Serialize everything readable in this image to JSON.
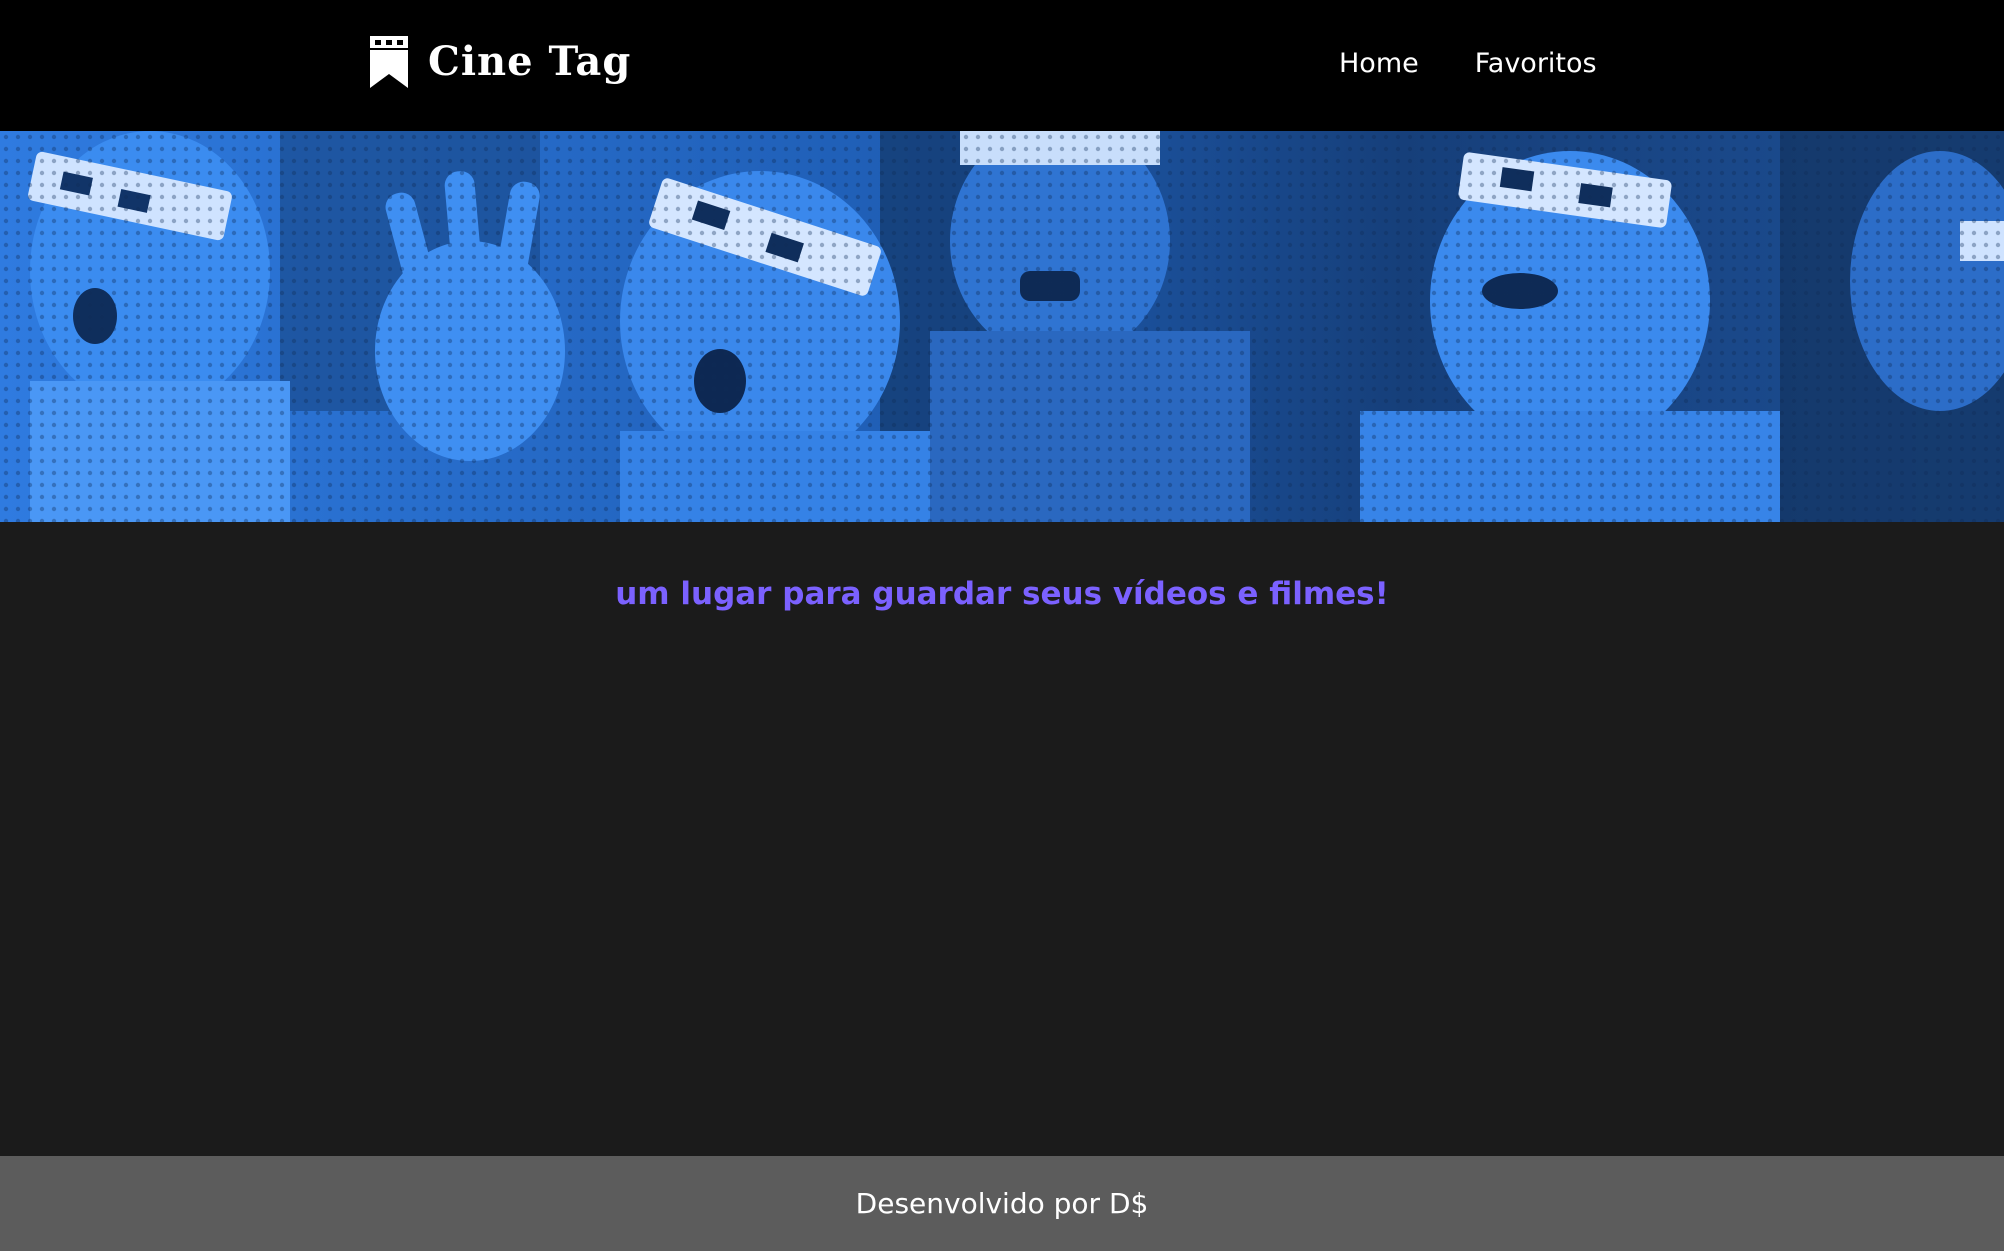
{
  "header": {
    "logo_text": "Cine Tag",
    "logo_icon": "bookmark-film-icon",
    "nav": [
      {
        "label": "Home"
      },
      {
        "label": "Favoritos"
      }
    ]
  },
  "banner": {
    "image_desc": "3d-cinema-audience-image"
  },
  "main": {
    "tagline": "um lugar para guardar seus vídeos e filmes!"
  },
  "footer": {
    "text": "Desenvolvido por D$"
  },
  "colors": {
    "header_bg": "#000000",
    "body_bg": "#1b1b1b",
    "banner_tint": "#2f7be0",
    "tagline": "#7b61ff",
    "footer_bg": "#5c5c5c",
    "text": "#ffffff"
  }
}
